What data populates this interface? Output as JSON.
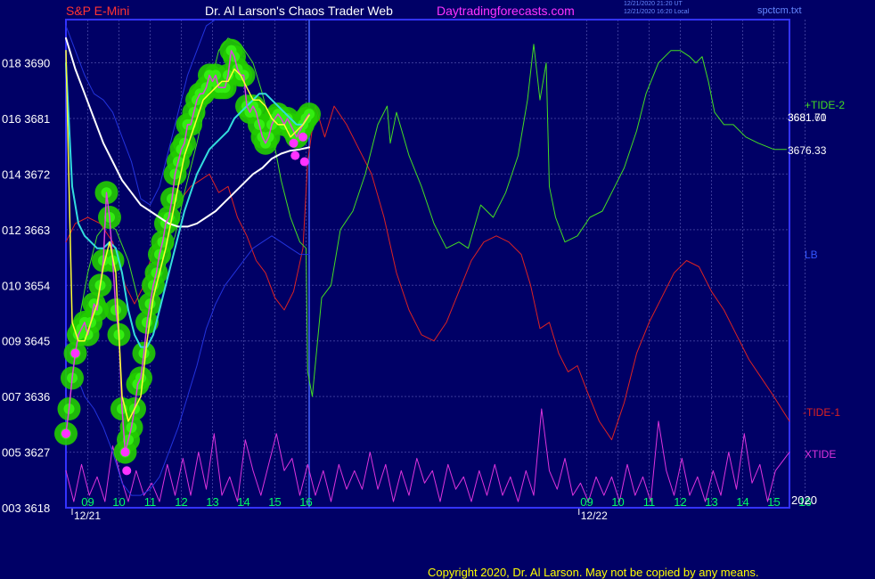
{
  "header": {
    "instrument": "S&P E-Mini",
    "site": "Dr. Al Larson's Chaos Trader Web",
    "url": "Daytradingforecasts.com",
    "stamp1": "12/21/2020 21:20 UT",
    "stamp2": "12/21/2020 16:20 Local",
    "file": "spctcm.txt"
  },
  "copyright": "Copyright 2020, Dr. Al Larson. May not be copied by any means.",
  "colors": {
    "background": "#000066",
    "plot_border": "#3333ff",
    "grid": "#3a3a99",
    "bubble": "#22cc00",
    "price": "#dd44dd",
    "fast_ma": "#ffff33",
    "mid_ma": "#33dddd",
    "slow_ma": "#ffffff",
    "band": "#2233dd",
    "tide_plus": "#44dd22",
    "tide_minus": "#dd2222",
    "xtide": "#dd33dd",
    "marker": "#ff33ff"
  },
  "chart_data": {
    "type": "line",
    "title": "S&P E-Mini",
    "y_ticks": [
      {
        "code": "003",
        "value": 3618
      },
      {
        "code": "005",
        "value": 3627
      },
      {
        "code": "007",
        "value": 3636
      },
      {
        "code": "009",
        "value": 3645
      },
      {
        "code": "010",
        "value": 3654
      },
      {
        "code": "012",
        "value": 3663
      },
      {
        "code": "014",
        "value": 3672
      },
      {
        "code": "016",
        "value": 3681
      },
      {
        "code": "018",
        "value": 3690
      }
    ],
    "ylim": [
      3618,
      3697
    ],
    "x_ticks": [
      "09",
      "10",
      "11",
      "12",
      "13",
      "14",
      "15",
      "16",
      "09",
      "10",
      "11",
      "12",
      "13",
      "14",
      "15",
      "16"
    ],
    "x_dates": [
      {
        "label": "12/21",
        "hour": 8.5
      },
      {
        "label": "12/22",
        "hour": 24.75
      }
    ],
    "xlim": [
      8.3,
      31.5
    ],
    "now_hour": 16.1,
    "year_label": "2020",
    "last_values": {
      "v1": "3681.70",
      "v2": "3681.61",
      "slow_ma": "3676.33"
    },
    "series_labels": {
      "tide_plus": "+TIDE-2",
      "lb": "LB",
      "tide_minus": "-TIDE-1",
      "xtide": "XTIDE"
    },
    "series": [
      {
        "key": "price",
        "x": [
          8.3,
          8.4,
          8.5,
          8.6,
          8.7,
          8.8,
          8.9,
          9.0,
          9.1,
          9.2,
          9.3,
          9.4,
          9.5,
          9.6,
          9.7,
          9.8,
          9.9,
          10.0,
          10.1,
          10.2,
          10.3,
          10.4,
          10.5,
          10.6,
          10.7,
          10.8,
          10.9,
          11.0,
          11.1,
          11.2,
          11.3,
          11.4,
          11.5,
          11.6,
          11.7,
          11.8,
          11.9,
          12.0,
          12.1,
          12.2,
          12.3,
          12.4,
          12.5,
          12.6,
          12.7,
          12.8,
          12.9,
          13.0,
          13.1,
          13.2,
          13.3,
          13.4,
          13.5,
          13.6,
          13.7,
          13.8,
          13.9,
          14.0,
          14.1,
          14.2,
          14.3,
          14.4,
          14.5,
          14.6,
          14.7,
          14.8,
          14.9,
          15.0,
          15.1,
          15.2,
          15.3,
          15.4,
          15.5,
          15.6,
          15.7,
          15.8,
          15.9,
          16.0,
          16.1
        ],
        "y": [
          3630,
          3634,
          3639,
          3643,
          3646,
          3647,
          3648,
          3646,
          3648,
          3651,
          3650,
          3654,
          3658,
          3669,
          3665,
          3658,
          3650,
          3646,
          3634,
          3627,
          3629,
          3631,
          3634,
          3638,
          3639,
          3643,
          3648,
          3651,
          3654,
          3656,
          3659,
          3661,
          3664,
          3665,
          3668,
          3672,
          3674,
          3676,
          3677,
          3680,
          3680,
          3682,
          3684,
          3685,
          3685,
          3686,
          3688,
          3687,
          3688,
          3686,
          3686,
          3686,
          3688,
          3692,
          3691,
          3689,
          3688,
          3688,
          3683,
          3682,
          3683,
          3682,
          3680,
          3678,
          3677,
          3678,
          3680,
          3681,
          3681.7,
          3681,
          3680,
          3681,
          3680,
          3679,
          3678,
          3679,
          3680,
          3681,
          3681.7
        ]
      },
      {
        "key": "fast_ma",
        "x": [
          8.3,
          8.5,
          8.7,
          8.9,
          9.1,
          9.3,
          9.5,
          9.7,
          9.9,
          10.1,
          10.3,
          10.5,
          10.7,
          10.9,
          11.1,
          11.3,
          11.5,
          11.7,
          11.9,
          12.1,
          12.3,
          12.5,
          12.7,
          12.9,
          13.1,
          13.3,
          13.5,
          13.7,
          13.9,
          14.1,
          14.3,
          14.5,
          14.7,
          14.9,
          15.1,
          15.3,
          15.5,
          15.7,
          15.9,
          16.1
        ],
        "y": [
          3692,
          3648,
          3645,
          3645,
          3648,
          3651,
          3657,
          3661,
          3656,
          3636,
          3632,
          3634,
          3636,
          3645,
          3652,
          3656,
          3660,
          3665,
          3670,
          3675,
          3678,
          3681,
          3684,
          3685,
          3686,
          3687,
          3687,
          3689,
          3688,
          3686,
          3684,
          3684,
          3683,
          3681,
          3680,
          3680,
          3678,
          3679,
          3680,
          3681.5
        ]
      },
      {
        "key": "mid_ma",
        "x": [
          8.3,
          8.5,
          8.7,
          8.9,
          9.1,
          9.3,
          9.5,
          9.7,
          9.9,
          10.1,
          10.3,
          10.5,
          10.7,
          10.9,
          11.1,
          11.3,
          11.5,
          11.7,
          11.9,
          12.1,
          12.3,
          12.5,
          12.7,
          12.9,
          13.1,
          13.3,
          13.5,
          13.7,
          13.9,
          14.1,
          14.3,
          14.5,
          14.7,
          14.9,
          15.1,
          15.3,
          15.5,
          15.7,
          15.9,
          16.1
        ],
        "y": [
          3690,
          3670,
          3664,
          3662,
          3661,
          3660,
          3660,
          3661,
          3660,
          3656,
          3650,
          3646,
          3644,
          3644,
          3646,
          3650,
          3654,
          3658,
          3662,
          3666,
          3669,
          3672,
          3674,
          3676,
          3677,
          3678,
          3679,
          3681,
          3682,
          3683,
          3684,
          3685,
          3685,
          3684,
          3683,
          3682,
          3681,
          3680,
          3680,
          3681.6
        ]
      },
      {
        "key": "slow_ma",
        "x": [
          8.3,
          8.6,
          8.9,
          9.2,
          9.5,
          9.8,
          10.1,
          10.4,
          10.7,
          11.0,
          11.3,
          11.6,
          11.9,
          12.2,
          12.5,
          12.8,
          13.1,
          13.4,
          13.7,
          14.0,
          14.3,
          14.6,
          14.9,
          15.2,
          15.5,
          15.8,
          16.1
        ],
        "y": [
          3694,
          3689,
          3685,
          3681,
          3677,
          3674,
          3671,
          3669,
          3667,
          3666,
          3665,
          3664,
          3663.5,
          3663.5,
          3664,
          3665,
          3666,
          3667.5,
          3669,
          3670.5,
          3672,
          3673,
          3674.5,
          3675.3,
          3675.8,
          3676,
          3676.33
        ]
      },
      {
        "key": "band_upper",
        "x": [
          8.3,
          8.6,
          8.9,
          9.2,
          9.5,
          9.8,
          10.1,
          10.4,
          10.7,
          11.0,
          11.3,
          11.6,
          11.9,
          12.2,
          12.5,
          12.8,
          13.1,
          13.4,
          13.7,
          14.0,
          14.3
        ],
        "y": [
          3696,
          3692,
          3688,
          3685,
          3684,
          3682,
          3678,
          3674,
          3668,
          3667,
          3670,
          3676,
          3682,
          3688,
          3692,
          3696,
          3697,
          3697,
          3697,
          3697,
          3697
        ]
      },
      {
        "key": "band_lower",
        "x": [
          8.3,
          8.6,
          8.9,
          9.2,
          9.5,
          9.8,
          10.1,
          10.4,
          10.7,
          11.0,
          11.3,
          11.6,
          11.9,
          12.2,
          12.5,
          12.8,
          13.1,
          13.4,
          13.7,
          14.0,
          14.3,
          14.6,
          14.9,
          15.2,
          15.5,
          15.8,
          16.1
        ],
        "y": [
          3645,
          3640,
          3636,
          3634,
          3631,
          3627,
          3622,
          3620,
          3620,
          3621,
          3623,
          3627,
          3631,
          3636,
          3641,
          3647,
          3651,
          3654,
          3656,
          3658,
          3660,
          3661,
          3662,
          3661,
          3660,
          3659,
          3659
        ]
      },
      {
        "key": "tide_plus",
        "x": [
          8.6,
          9.0,
          9.3,
          9.6,
          9.9,
          10.3,
          10.7,
          11.0,
          11.4,
          11.8,
          12.1,
          12.5,
          12.9,
          13.2,
          13.5,
          13.9,
          14.3,
          14.6,
          14.9,
          15.2,
          15.5,
          15.8,
          16.0,
          16.05,
          16.2,
          16.5,
          16.8,
          17.1,
          17.5,
          17.9,
          18.3,
          18.6,
          18.7,
          18.9,
          19.3,
          19.7,
          20.1,
          20.5,
          20.9,
          21.2,
          21.6,
          22.0,
          22.4,
          22.8,
          23.1,
          23.3,
          23.5,
          23.7,
          23.8,
          24.0,
          24.3,
          24.7,
          25.1,
          25.5,
          25.9,
          26.2,
          26.6,
          26.9,
          27.3,
          27.7,
          28.0,
          28.3,
          28.5,
          28.7,
          28.9,
          29.1,
          29.4,
          29.7,
          30.1,
          30.5,
          31.0,
          31.4
        ],
        "y": [
          3645,
          3656,
          3662,
          3664,
          3663,
          3658,
          3650,
          3650,
          3656,
          3662,
          3669,
          3677,
          3686,
          3692,
          3694,
          3693,
          3690,
          3685,
          3679,
          3671,
          3665,
          3661,
          3660,
          3640,
          3636,
          3652,
          3654,
          3663,
          3666,
          3672,
          3680,
          3683,
          3677,
          3682,
          3675,
          3670,
          3664,
          3660,
          3661,
          3660,
          3667,
          3665,
          3669,
          3675,
          3684,
          3693,
          3684,
          3690,
          3670,
          3665,
          3661,
          3662,
          3665,
          3666,
          3670,
          3673,
          3679,
          3685,
          3690,
          3692,
          3692,
          3691,
          3690,
          3691,
          3687,
          3682,
          3680,
          3680,
          3678,
          3677,
          3676,
          3676
        ]
      },
      {
        "key": "tide_minus",
        "x": [
          8.3,
          8.6,
          9.0,
          9.4,
          9.8,
          10.2,
          10.5,
          10.8,
          11.1,
          11.4,
          11.7,
          12.0,
          12.3,
          12.6,
          12.9,
          13.2,
          13.5,
          13.8,
          14.1,
          14.4,
          14.7,
          15.0,
          15.3,
          15.6,
          15.9,
          16.05,
          16.3,
          16.6,
          16.9,
          17.3,
          17.7,
          18.1,
          18.5,
          18.9,
          19.3,
          19.7,
          20.1,
          20.5,
          20.9,
          21.3,
          21.7,
          22.1,
          22.5,
          22.9,
          23.2,
          23.5,
          23.8,
          24.1,
          24.4,
          24.7,
          25.0,
          25.4,
          25.8,
          26.2,
          26.6,
          27.0,
          27.4,
          27.8,
          28.2,
          28.6,
          29.0,
          29.4,
          29.8,
          30.2,
          30.6,
          31.0,
          31.5
        ],
        "y": [
          3661,
          3664,
          3665,
          3664,
          3661,
          3654,
          3651,
          3654,
          3660,
          3663,
          3666,
          3668,
          3670,
          3671,
          3672,
          3669,
          3670,
          3665,
          3662,
          3658,
          3656,
          3652,
          3650,
          3653,
          3660,
          3674,
          3683,
          3678,
          3683,
          3680,
          3676,
          3672,
          3665,
          3656,
          3650,
          3646,
          3645,
          3648,
          3653,
          3658,
          3661,
          3662,
          3661,
          3659,
          3654,
          3647,
          3648,
          3643,
          3640,
          3641,
          3637,
          3632,
          3629,
          3635,
          3643,
          3648,
          3652,
          3656,
          3658,
          3657,
          3653,
          3650,
          3646,
          3642,
          3639,
          3636,
          3632
        ]
      },
      {
        "key": "xtide",
        "x": [
          8.3,
          8.55,
          8.8,
          9.05,
          9.3,
          9.55,
          9.8,
          10.05,
          10.3,
          10.55,
          10.8,
          11.05,
          11.3,
          11.55,
          11.8,
          12.05,
          12.3,
          12.55,
          12.8,
          13.05,
          13.3,
          13.55,
          13.8,
          14.05,
          14.3,
          14.55,
          14.8,
          15.05,
          15.3,
          15.55,
          15.8,
          16.05,
          16.3,
          16.55,
          16.8,
          17.05,
          17.3,
          17.55,
          17.8,
          18.05,
          18.3,
          18.55,
          18.8,
          19.05,
          19.3,
          19.55,
          19.8,
          20.05,
          20.3,
          20.55,
          20.8,
          21.05,
          21.3,
          21.55,
          21.8,
          22.05,
          22.3,
          22.55,
          22.8,
          23.05,
          23.3,
          23.55,
          23.8,
          24.05,
          24.3,
          24.55,
          24.8,
          25.05,
          25.3,
          25.55,
          25.8,
          26.05,
          26.3,
          26.55,
          26.8,
          27.05,
          27.3,
          27.55,
          27.8,
          28.05,
          28.3,
          28.55,
          28.8,
          29.05,
          29.3,
          29.55,
          29.8,
          30.05,
          30.3,
          30.55,
          30.8,
          31.05,
          31.5
        ],
        "y": [
          3624,
          3619,
          3625,
          3620,
          3623,
          3619,
          3628,
          3623,
          3619,
          3624,
          3620,
          3622,
          3619,
          3625,
          3620,
          3626,
          3620,
          3627,
          3621,
          3630,
          3620,
          3623,
          3619,
          3629,
          3624,
          3620,
          3625,
          3630,
          3624,
          3626,
          3620,
          3625,
          3620,
          3624,
          3619,
          3625,
          3621,
          3624,
          3621,
          3627,
          3621,
          3625,
          3619,
          3624,
          3620,
          3626,
          3622,
          3624,
          3619,
          3625,
          3621,
          3623,
          3619,
          3624,
          3620,
          3625,
          3620,
          3623,
          3619,
          3624,
          3620,
          3634,
          3624,
          3621,
          3626,
          3620,
          3622,
          3619,
          3623,
          3620,
          3623,
          3619,
          3625,
          3620,
          3623,
          3619,
          3632,
          3624,
          3620,
          3626,
          3620,
          3623,
          3619,
          3624,
          3620,
          3627,
          3621,
          3630,
          3622,
          3625,
          3619,
          3624,
          3627
        ]
      }
    ],
    "markers": [
      {
        "x": 8.3,
        "y": 3630
      },
      {
        "x": 8.6,
        "y": 3643
      },
      {
        "x": 10.2,
        "y": 3627
      },
      {
        "x": 10.25,
        "y": 3624
      },
      {
        "x": 15.6,
        "y": 3677
      },
      {
        "x": 15.65,
        "y": 3675
      },
      {
        "x": 15.9,
        "y": 3678
      },
      {
        "x": 15.95,
        "y": 3674
      }
    ]
  }
}
